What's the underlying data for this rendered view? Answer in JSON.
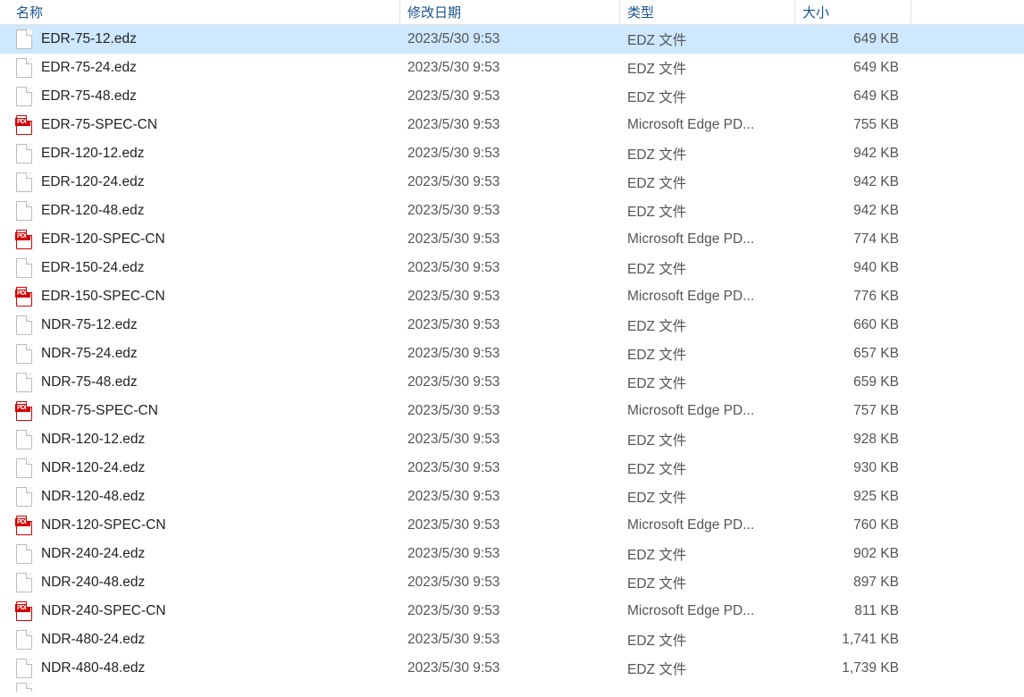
{
  "columns": {
    "name": "名称",
    "date": "修改日期",
    "type": "类型",
    "size": "大小"
  },
  "type_labels": {
    "edz": "EDZ 文件",
    "pdf": "Microsoft Edge PD..."
  },
  "files": [
    {
      "name": "EDR-75-12.edz",
      "date": "2023/5/30 9:53",
      "type_key": "edz",
      "size": "649 KB",
      "icon": "generic",
      "selected": true
    },
    {
      "name": "EDR-75-24.edz",
      "date": "2023/5/30 9:53",
      "type_key": "edz",
      "size": "649 KB",
      "icon": "generic",
      "selected": false
    },
    {
      "name": "EDR-75-48.edz",
      "date": "2023/5/30 9:53",
      "type_key": "edz",
      "size": "649 KB",
      "icon": "generic",
      "selected": false
    },
    {
      "name": "EDR-75-SPEC-CN",
      "date": "2023/5/30 9:53",
      "type_key": "pdf",
      "size": "755 KB",
      "icon": "pdf",
      "selected": false
    },
    {
      "name": "EDR-120-12.edz",
      "date": "2023/5/30 9:53",
      "type_key": "edz",
      "size": "942 KB",
      "icon": "generic",
      "selected": false
    },
    {
      "name": "EDR-120-24.edz",
      "date": "2023/5/30 9:53",
      "type_key": "edz",
      "size": "942 KB",
      "icon": "generic",
      "selected": false
    },
    {
      "name": "EDR-120-48.edz",
      "date": "2023/5/30 9:53",
      "type_key": "edz",
      "size": "942 KB",
      "icon": "generic",
      "selected": false
    },
    {
      "name": "EDR-120-SPEC-CN",
      "date": "2023/5/30 9:53",
      "type_key": "pdf",
      "size": "774 KB",
      "icon": "pdf",
      "selected": false
    },
    {
      "name": "EDR-150-24.edz",
      "date": "2023/5/30 9:53",
      "type_key": "edz",
      "size": "940 KB",
      "icon": "generic",
      "selected": false
    },
    {
      "name": "EDR-150-SPEC-CN",
      "date": "2023/5/30 9:53",
      "type_key": "pdf",
      "size": "776 KB",
      "icon": "pdf",
      "selected": false
    },
    {
      "name": "NDR-75-12.edz",
      "date": "2023/5/30 9:53",
      "type_key": "edz",
      "size": "660 KB",
      "icon": "generic",
      "selected": false
    },
    {
      "name": "NDR-75-24.edz",
      "date": "2023/5/30 9:53",
      "type_key": "edz",
      "size": "657 KB",
      "icon": "generic",
      "selected": false
    },
    {
      "name": "NDR-75-48.edz",
      "date": "2023/5/30 9:53",
      "type_key": "edz",
      "size": "659 KB",
      "icon": "generic",
      "selected": false
    },
    {
      "name": "NDR-75-SPEC-CN",
      "date": "2023/5/30 9:53",
      "type_key": "pdf",
      "size": "757 KB",
      "icon": "pdf",
      "selected": false
    },
    {
      "name": "NDR-120-12.edz",
      "date": "2023/5/30 9:53",
      "type_key": "edz",
      "size": "928 KB",
      "icon": "generic",
      "selected": false
    },
    {
      "name": "NDR-120-24.edz",
      "date": "2023/5/30 9:53",
      "type_key": "edz",
      "size": "930 KB",
      "icon": "generic",
      "selected": false
    },
    {
      "name": "NDR-120-48.edz",
      "date": "2023/5/30 9:53",
      "type_key": "edz",
      "size": "925 KB",
      "icon": "generic",
      "selected": false
    },
    {
      "name": "NDR-120-SPEC-CN",
      "date": "2023/5/30 9:53",
      "type_key": "pdf",
      "size": "760 KB",
      "icon": "pdf",
      "selected": false
    },
    {
      "name": "NDR-240-24.edz",
      "date": "2023/5/30 9:53",
      "type_key": "edz",
      "size": "902 KB",
      "icon": "generic",
      "selected": false
    },
    {
      "name": "NDR-240-48.edz",
      "date": "2023/5/30 9:53",
      "type_key": "edz",
      "size": "897 KB",
      "icon": "generic",
      "selected": false
    },
    {
      "name": "NDR-240-SPEC-CN",
      "date": "2023/5/30 9:53",
      "type_key": "pdf",
      "size": "811 KB",
      "icon": "pdf",
      "selected": false
    },
    {
      "name": "NDR-480-24.edz",
      "date": "2023/5/30 9:53",
      "type_key": "edz",
      "size": "1,741 KB",
      "icon": "generic",
      "selected": false
    },
    {
      "name": "NDR-480-48.edz",
      "date": "2023/5/30 9:53",
      "type_key": "edz",
      "size": "1,739 KB",
      "icon": "generic",
      "selected": false
    }
  ]
}
